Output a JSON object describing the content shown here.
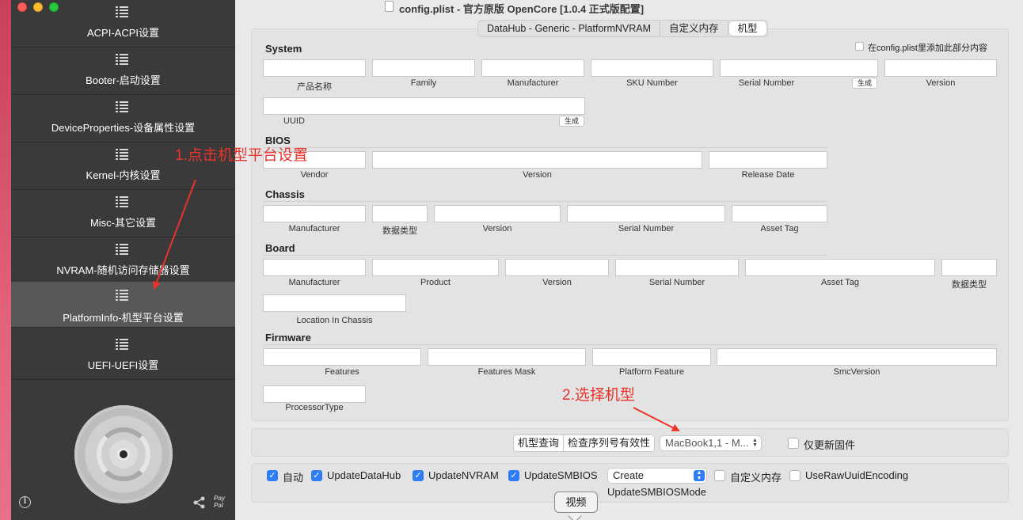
{
  "window": {
    "title": "config.plist - 官方原版 OpenCore [1.0.4 正式版配置]"
  },
  "sidebar": {
    "items": [
      {
        "label": "ACPI-ACPI设置",
        "active": false
      },
      {
        "label": "Booter-启动设置",
        "active": false
      },
      {
        "label": "DeviceProperties-设备属性设置",
        "active": false
      },
      {
        "label": "Kernel-内核设置",
        "active": false
      },
      {
        "label": "Misc-其它设置",
        "active": false
      },
      {
        "label": "NVRAM-随机访问存储器设置",
        "active": false
      },
      {
        "label": "PlatformInfo-机型平台设置",
        "active": true
      },
      {
        "label": "UEFI-UEFI设置",
        "active": false
      }
    ],
    "paypal_text": "Pay Pal"
  },
  "annotations": {
    "step1": "1.点击机型平台设置",
    "step2": "2.选择机型"
  },
  "tabs": [
    "DataHub - Generic - PlatformNVRAM",
    "自定义内存",
    "机型"
  ],
  "add_to_config": "在config.plist里添加此部分内容",
  "system": {
    "title": "System",
    "labels": [
      "产品名称",
      "Family",
      "Manufacturer",
      "SKU Number",
      "Serial Number",
      "Version",
      "UUID"
    ],
    "generate": "生成"
  },
  "bios": {
    "title": "BIOS",
    "labels": [
      "Vendor",
      "Version",
      "Release Date"
    ]
  },
  "chassis": {
    "title": "Chassis",
    "labels": [
      "Manufacturer",
      "数据类型",
      "Version",
      "Serial Number",
      "Asset Tag"
    ]
  },
  "board": {
    "title": "Board",
    "labels": [
      "Manufacturer",
      "Product",
      "Version",
      "Serial Number",
      "Asset Tag",
      "数据类型",
      "Location In Chassis"
    ]
  },
  "firmware": {
    "title": "Firmware",
    "labels": [
      "Features",
      "Features Mask",
      "Platform Feature",
      "SmcVersion",
      "ProcessorType"
    ]
  },
  "model_bar": {
    "query": "机型查询",
    "check_serial": "检查序列号有效性",
    "model_select": "MacBook1,1 - M...",
    "update_fw_only": "仅更新固件"
  },
  "options": {
    "auto": "自动",
    "update_datahub": "UpdateDataHub",
    "update_nvram": "UpdateNVRAM",
    "update_smbios": "UpdateSMBIOS",
    "smbios_mode_value": "Create",
    "smbios_mode_label": "UpdateSMBIOSMode",
    "custom_memory": "自定义内存",
    "raw_uuid": "UseRawUuidEncoding"
  },
  "tooltip": "视频",
  "colors": {
    "sidebar_bg": "#3a3a3a",
    "sidebar_active": "#585858",
    "accent": "#2e7cf6",
    "annotation": "#e8342a"
  }
}
